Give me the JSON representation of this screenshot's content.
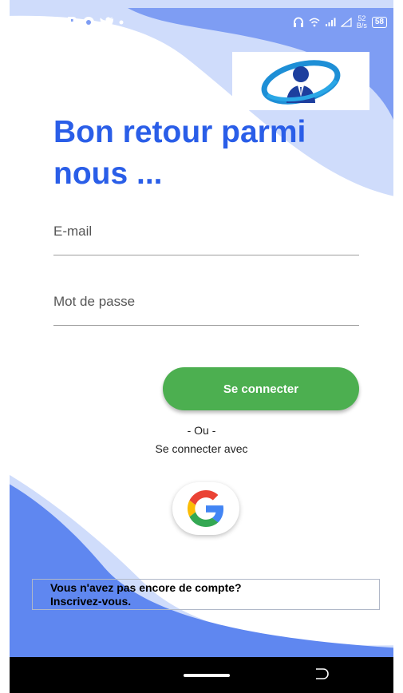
{
  "status_bar": {
    "time": "23:49",
    "speed_top": "52",
    "speed_bottom": "B/s",
    "battery": "58"
  },
  "title": {
    "line1": "Bon retour parmi",
    "line2": "nous ..."
  },
  "form": {
    "email_placeholder": "E-mail",
    "password_placeholder": "Mot de passe"
  },
  "login_button": "Se connecter",
  "or_text": "- Ou -",
  "connect_with_text": "Se connecter avec",
  "signup": {
    "line1": "Vous n'avez pas encore de compte?",
    "line2": "Inscrivez-vous."
  },
  "colors": {
    "primary_blue": "#2a5ee8",
    "light_blue": "#cfdcfb",
    "mid_blue": "#7e9df3",
    "button_green": "#4caf50"
  },
  "icons": {
    "logo": "businessman-logo",
    "google": "google-g-icon",
    "back": "nav-back-icon"
  }
}
